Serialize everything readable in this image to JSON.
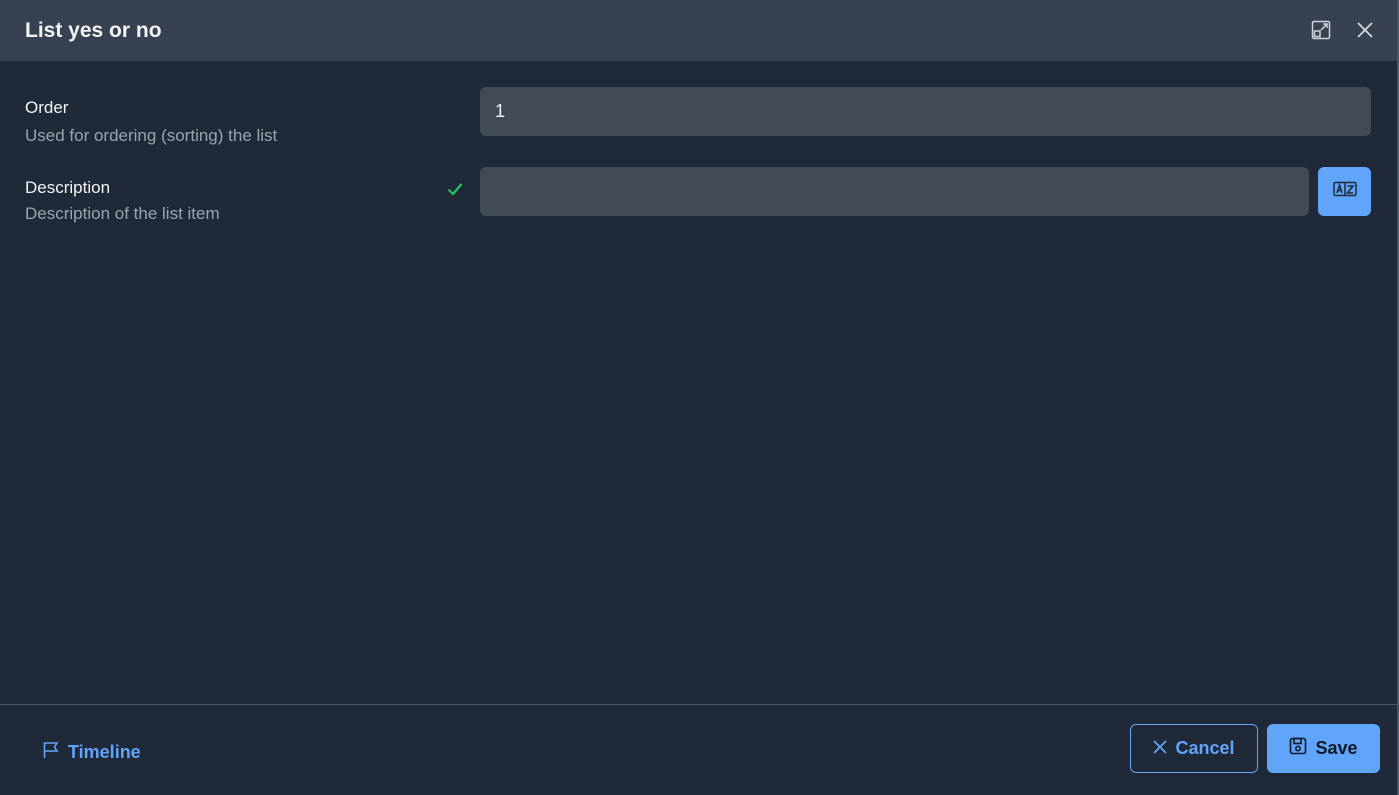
{
  "dialog": {
    "title": "List yes or no",
    "expand_icon": "expand-icon",
    "close_icon": "close-icon"
  },
  "fields": [
    {
      "label": "Order",
      "help": "Used for ordering (sorting) the list",
      "value": "1"
    },
    {
      "label": "Description",
      "help": "Description of the list item",
      "value": "",
      "status_icon": "check-icon",
      "action_icon": "translate-icon"
    }
  ],
  "footer": {
    "timeline_label": "Timeline",
    "cancel_label": "Cancel",
    "save_label": "Save"
  },
  "colors": {
    "accent": "#60a5fa",
    "success": "#22c55e",
    "background": "#1f2937",
    "header": "#374151",
    "input": "#434a57"
  }
}
